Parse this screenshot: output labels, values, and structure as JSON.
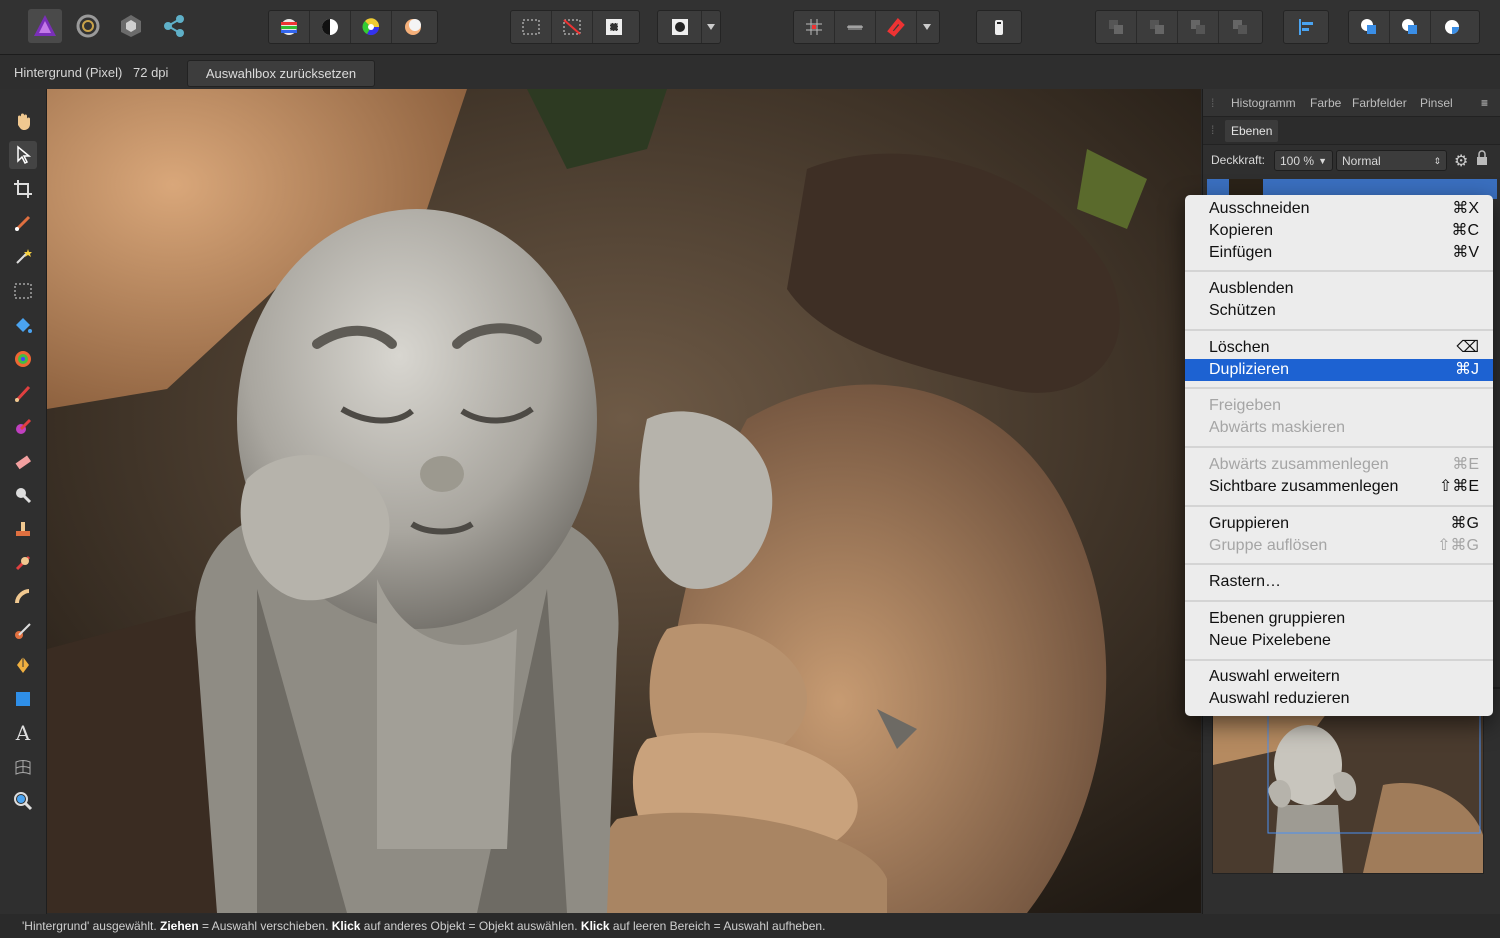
{
  "context": {
    "layer_info": "Hintergrund (Pixel)",
    "dpi": "72 dpi",
    "reset_button": "Auswahlbox zurücksetzen"
  },
  "panel": {
    "tabs": [
      "Histogramm",
      "Farbe",
      "Farbfelder",
      "Pinsel"
    ],
    "layers_tab": "Ebenen",
    "opacity_label": "Deckkraft:",
    "opacity_value": "100 %",
    "blend_mode": "Normal"
  },
  "menu": {
    "items": [
      {
        "label": "Ausschneiden",
        "shortcut": "⌘X",
        "enabled": true
      },
      {
        "label": "Kopieren",
        "shortcut": "⌘C",
        "enabled": true
      },
      {
        "label": "Einfügen",
        "shortcut": "⌘V",
        "enabled": true
      },
      {
        "label": "Ausblenden",
        "shortcut": "",
        "enabled": true
      },
      {
        "label": "Schützen",
        "shortcut": "",
        "enabled": true
      },
      {
        "label": "Löschen",
        "shortcut": "⌫",
        "enabled": true
      },
      {
        "label": "Duplizieren",
        "shortcut": "⌘J",
        "enabled": true,
        "selected": true
      },
      {
        "label": "Freigeben",
        "shortcut": "",
        "enabled": false
      },
      {
        "label": "Abwärts maskieren",
        "shortcut": "",
        "enabled": false
      },
      {
        "label": "Abwärts zusammenlegen",
        "shortcut": "⌘E",
        "enabled": false
      },
      {
        "label": "Sichtbare zusammenlegen",
        "shortcut": "⇧⌘E",
        "enabled": true
      },
      {
        "label": "Gruppieren",
        "shortcut": "⌘G",
        "enabled": true
      },
      {
        "label": "Gruppe auflösen",
        "shortcut": "⇧⌘G",
        "enabled": false
      },
      {
        "label": "Rastern…",
        "shortcut": "",
        "enabled": true
      },
      {
        "label": "Ebenen gruppieren",
        "shortcut": "",
        "enabled": true
      },
      {
        "label": "Neue Pixelebene",
        "shortcut": "",
        "enabled": true
      },
      {
        "label": "Auswahl erweitern",
        "shortcut": "",
        "enabled": true
      },
      {
        "label": "Auswahl reduzieren",
        "shortcut": "",
        "enabled": true
      }
    ]
  },
  "status": {
    "part1": "'Hintergrund' ausgewählt. ",
    "bold1": "Ziehen",
    "part2": " = Auswahl verschieben. ",
    "bold2": "Klick",
    "part3": " auf anderes Objekt = Objekt auswählen. ",
    "bold3": "Klick",
    "part4": " auf leeren Bereich = Auswahl aufheben."
  },
  "colors": {
    "accent": "#1d62d2",
    "app_bg": "#2b2b2b",
    "menu_bg": "#ececec"
  }
}
